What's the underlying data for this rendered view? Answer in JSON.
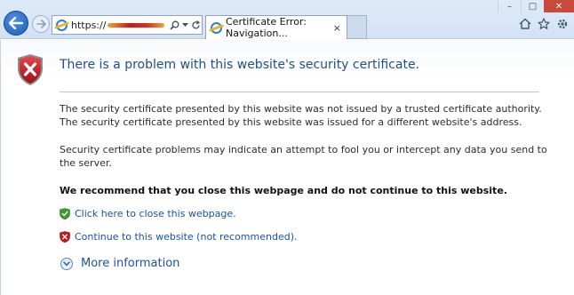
{
  "browser": {
    "address_url": "https://",
    "tab_title": "Certificate Error: Navigation...",
    "tab_close": "×",
    "window_controls": {
      "minimize": "–",
      "maximize": "□",
      "close": "✕"
    },
    "icons": [
      "back-arrow-icon",
      "forward-arrow-icon",
      "search-icon",
      "dropdown-icon",
      "refresh-icon",
      "home-icon",
      "favorites-star-icon",
      "tools-gear-icon"
    ]
  },
  "page": {
    "title": "There is a problem with this website's security certificate.",
    "paragraph1_line1": "The security certificate presented by this website was not issued by a trusted certificate authority.",
    "paragraph1_line2": "The security certificate presented by this website was issued for a different website's address.",
    "paragraph2": "Security certificate problems may indicate an attempt to fool you or intercept any data you send to the server.",
    "recommendation": "We recommend that you close this webpage and do not continue to this website.",
    "close_link": "Click here to close this webpage.",
    "continue_link": "Continue to this website (not recommended).",
    "more_info": "More information"
  },
  "colors": {
    "title_blue": "#1f4e8c",
    "link_blue": "#1a53a3",
    "shield_red": "#c8171a",
    "shield_green": "#3d9a2c"
  }
}
